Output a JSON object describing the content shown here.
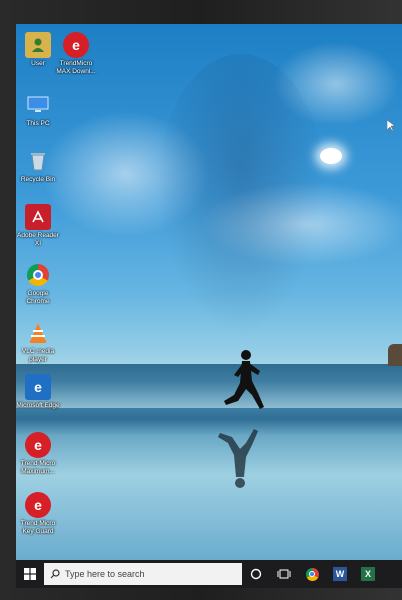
{
  "desktop": {
    "icons": [
      {
        "label": "User",
        "icon": "user-folder-icon",
        "color": "#d8b24a"
      },
      {
        "label": "TrendMicro MAX Downl...",
        "icon": "trend-micro-icon",
        "color": "#d61f26"
      },
      {
        "label": "This PC",
        "icon": "this-pc-icon",
        "color": "#3a8ee6"
      },
      {
        "label": "Recycle Bin",
        "icon": "recycle-bin-icon",
        "color": "#9fb7c9"
      },
      {
        "label": "Adobe Reader XI",
        "icon": "adobe-reader-icon",
        "color": "#c8202a"
      },
      {
        "label": "Google Chrome",
        "icon": "chrome-icon",
        "color": "#4285f4"
      },
      {
        "label": "VLC media player",
        "icon": "vlc-icon",
        "color": "#f58220"
      },
      {
        "label": "Microsoft Edge",
        "icon": "edge-icon",
        "color": "#1f6fc5"
      },
      {
        "label": "Trend Micro Maximum...",
        "icon": "trend-micro-icon",
        "color": "#d61f26"
      },
      {
        "label": "Trend Micro Key Guard",
        "icon": "trend-micro-key-icon",
        "color": "#d61f26"
      }
    ]
  },
  "taskbar": {
    "search_placeholder": "Type here to search",
    "buttons": [
      {
        "name": "cortana",
        "icon": "cortana-circle-icon"
      },
      {
        "name": "task-view",
        "icon": "task-view-icon"
      },
      {
        "name": "chrome",
        "icon": "chrome-icon"
      },
      {
        "name": "word",
        "icon": "word-icon",
        "color": "#2b579a",
        "letter": "W"
      },
      {
        "name": "excel",
        "icon": "excel-icon",
        "color": "#217346",
        "letter": "X"
      }
    ]
  }
}
